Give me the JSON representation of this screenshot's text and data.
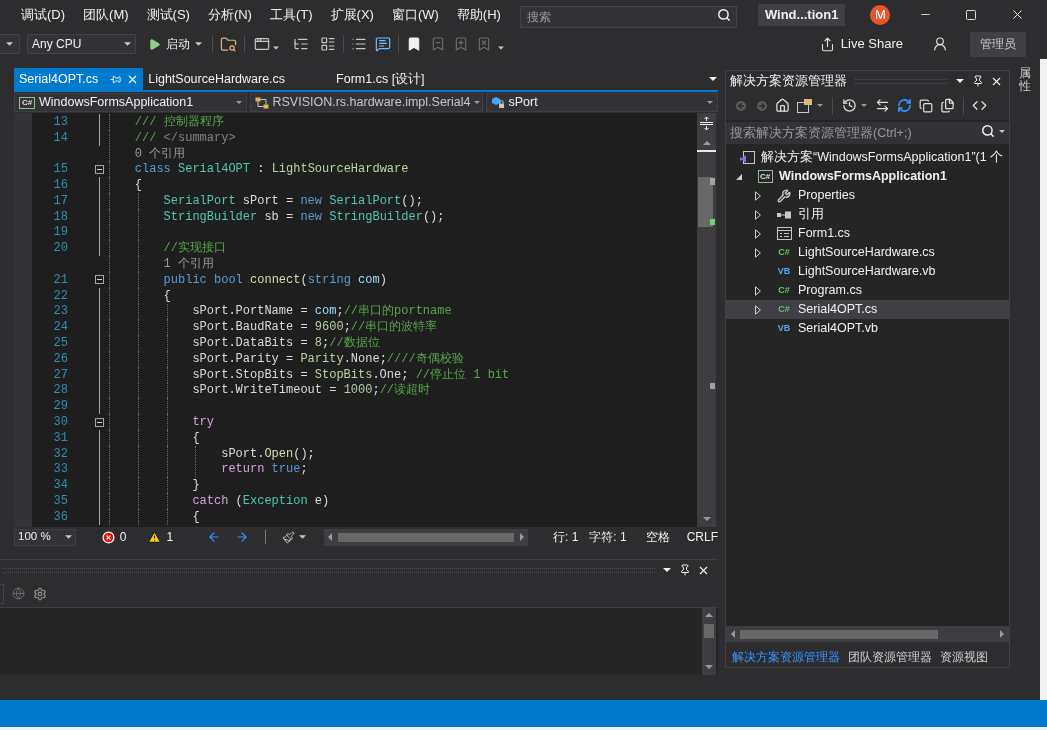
{
  "menu_bar": {
    "items": [
      "调试(D)",
      "团队(M)",
      "测试(S)",
      "分析(N)",
      "工具(T)",
      "扩展(X)",
      "窗口(W)",
      "帮助(H)"
    ],
    "search": {
      "placeholder": "搜索"
    },
    "solution_title": "Wind...tion1",
    "avatar": "M"
  },
  "toolbar": {
    "platform": "Any CPU",
    "start": "启动",
    "live_share": "Live Share",
    "account": "管理员"
  },
  "editor": {
    "tabs": [
      {
        "label": "Serial4OPT.cs",
        "selected": true
      },
      {
        "label": "LightSourceHardware.cs",
        "selected": false
      },
      {
        "label": "Form1.cs [设计]",
        "selected": false
      }
    ],
    "navigation": [
      {
        "kind": "project",
        "icon_text": "C#",
        "text": "WindowsFormsApplication1"
      },
      {
        "kind": "class",
        "text": "RSVISION.rs.hardware.impl.Serial4"
      },
      {
        "kind": "field",
        "text": "sPort"
      }
    ],
    "lines": [
      {
        "kind": "code",
        "number": "13",
        "tokens": [
          {
            "kind": "comment",
            "text": "/// 控制器程序"
          }
        ]
      },
      {
        "kind": "code",
        "number": "14",
        "tokens": [
          {
            "kind": "comment",
            "text": "///"
          },
          {
            "kind": "doc",
            "text": " </summary>"
          }
        ]
      },
      {
        "kind": "codelens",
        "text": "0 个引用"
      },
      {
        "kind": "code",
        "number": "15",
        "expanded": true,
        "tokens": [
          {
            "kind": "keyword",
            "text": "class"
          },
          {
            "kind": "type",
            "text": " Serial4OPT"
          },
          {
            "kind": "plain",
            "text": " : "
          },
          {
            "kind": "enum",
            "text": "LightSourceHardware"
          }
        ]
      },
      {
        "kind": "code",
        "number": "16",
        "tokens": [
          {
            "kind": "plain",
            "text": "{"
          }
        ],
        "children": [
          {
            "kind": "code",
            "number": "17",
            "tokens": [
              {
                "kind": "type",
                "text": "SerialPort"
              },
              {
                "kind": "plain",
                "text": " sPort = "
              },
              {
                "kind": "keyword",
                "text": "new"
              },
              {
                "kind": "type",
                "text": " SerialPort"
              },
              {
                "kind": "plain",
                "text": "();"
              }
            ]
          },
          {
            "kind": "code",
            "number": "18",
            "tokens": [
              {
                "kind": "type",
                "text": "StringBuilder"
              },
              {
                "kind": "plain",
                "text": " sb = "
              },
              {
                "kind": "keyword",
                "text": "new"
              },
              {
                "kind": "type",
                "text": " StringBuilder"
              },
              {
                "kind": "plain",
                "text": "();"
              }
            ]
          },
          {
            "kind": "code",
            "number": "19"
          },
          {
            "kind": "code",
            "number": "20",
            "tokens": [
              {
                "kind": "comment",
                "text": "//实现接口"
              }
            ]
          },
          {
            "kind": "codelens",
            "text": "1 个引用"
          },
          {
            "kind": "code",
            "number": "21",
            "expanded": true,
            "tokens": [
              {
                "kind": "keyword",
                "text": "public"
              },
              {
                "kind": "keyword",
                "text": " bool"
              },
              {
                "kind": "method",
                "text": " connect"
              },
              {
                "kind": "plain",
                "text": "("
              },
              {
                "kind": "keyword",
                "text": "string"
              },
              {
                "kind": "param",
                "text": " com"
              },
              {
                "kind": "plain",
                "text": ")"
              }
            ]
          },
          {
            "kind": "code",
            "number": "22",
            "tokens": [
              {
                "kind": "plain",
                "text": "{"
              }
            ],
            "children": [
              {
                "kind": "code",
                "number": "23",
                "tokens": [
                  {
                    "kind": "plain",
                    "text": "sPort.PortName = "
                  },
                  {
                    "kind": "param",
                    "text": "com"
                  },
                  {
                    "kind": "plain",
                    "text": ";"
                  },
                  {
                    "kind": "comment",
                    "text": "//串口的portname"
                  }
                ]
              },
              {
                "kind": "code",
                "number": "24",
                "tokens": [
                  {
                    "kind": "plain",
                    "text": "sPort.BaudRate = "
                  },
                  {
                    "kind": "number",
                    "text": "9600"
                  },
                  {
                    "kind": "plain",
                    "text": ";"
                  },
                  {
                    "kind": "comment",
                    "text": "//串口的波特率"
                  }
                ]
              },
              {
                "kind": "code",
                "number": "25",
                "tokens": [
                  {
                    "kind": "plain",
                    "text": "sPort.DataBits = "
                  },
                  {
                    "kind": "number",
                    "text": "8"
                  },
                  {
                    "kind": "plain",
                    "text": ";"
                  },
                  {
                    "kind": "comment",
                    "text": "//数据位"
                  }
                ]
              },
              {
                "kind": "code",
                "number": "26",
                "tokens": [
                  {
                    "kind": "plain",
                    "text": "sPort.Parity = "
                  },
                  {
                    "kind": "enum",
                    "text": "Parity"
                  },
                  {
                    "kind": "plain",
                    "text": ".None;"
                  },
                  {
                    "kind": "comment",
                    "text": "////奇偶校验"
                  }
                ]
              },
              {
                "kind": "code",
                "number": "27",
                "tokens": [
                  {
                    "kind": "plain",
                    "text": "sPort.StopBits = "
                  },
                  {
                    "kind": "enum",
                    "text": "StopBits"
                  },
                  {
                    "kind": "plain",
                    "text": ".One; "
                  },
                  {
                    "kind": "comment",
                    "text": "//停止位 1 bit"
                  }
                ]
              },
              {
                "kind": "code",
                "number": "28",
                "tokens": [
                  {
                    "kind": "plain",
                    "text": "sPort.WriteTimeout = "
                  },
                  {
                    "kind": "number",
                    "text": "1000"
                  },
                  {
                    "kind": "plain",
                    "text": ";"
                  },
                  {
                    "kind": "comment",
                    "text": "//读超时"
                  }
                ]
              },
              {
                "kind": "code",
                "number": "29"
              },
              {
                "kind": "code",
                "number": "30",
                "expanded": true,
                "tokens": [
                  {
                    "kind": "control",
                    "text": "try"
                  }
                ]
              },
              {
                "kind": "code",
                "number": "31",
                "tokens": [
                  {
                    "kind": "plain",
                    "text": "{"
                  }
                ],
                "children": [
                  {
                    "kind": "code",
                    "number": "32",
                    "tokens": [
                      {
                        "kind": "plain",
                        "text": "sPort."
                      },
                      {
                        "kind": "method",
                        "text": "Open"
                      },
                      {
                        "kind": "plain",
                        "text": "();"
                      }
                    ]
                  },
                  {
                    "kind": "code",
                    "number": "33",
                    "tokens": [
                      {
                        "kind": "control",
                        "text": "return"
                      },
                      {
                        "kind": "keyword",
                        "text": " true"
                      },
                      {
                        "kind": "plain",
                        "text": ";"
                      }
                    ]
                  }
                ]
              },
              {
                "kind": "code",
                "number": "34",
                "tokens": [
                  {
                    "kind": "plain",
                    "text": "}"
                  }
                ]
              },
              {
                "kind": "code",
                "number": "35",
                "tokens": [
                  {
                    "kind": "control",
                    "text": "catch"
                  },
                  {
                    "kind": "plain",
                    "text": " ("
                  },
                  {
                    "kind": "type",
                    "text": "Exception"
                  },
                  {
                    "kind": "plain",
                    "text": " e)"
                  }
                ]
              },
              {
                "kind": "code",
                "number": "36",
                "tokens": [
                  {
                    "kind": "plain",
                    "text": "{"
                  }
                ]
              }
            ]
          }
        ]
      }
    ],
    "status": {
      "zoom": "100 %",
      "errors": "0",
      "warnings": "1",
      "line": "行: 1",
      "column": "字符: 1",
      "indentation": "空格",
      "line_ending": "CRLF"
    }
  },
  "solution_explorer": {
    "title": "解决方案资源管理器",
    "search": {
      "placeholder": "搜索解决方案资源管理器(Ctrl+;)"
    },
    "tree": [
      {
        "kind": "solution",
        "label": "解决方案“WindowsFormsApplication1”(1 个",
        "selected": false,
        "children": [
          {
            "kind": "project",
            "icon_text": "C#",
            "label": "WindowsFormsApplication1",
            "expanded": true,
            "selected": false,
            "children": [
              {
                "kind": "properties",
                "label": "Properties",
                "expanded": false,
                "selected": false
              },
              {
                "kind": "references",
                "label": "引用",
                "expanded": false,
                "selected": false
              },
              {
                "kind": "form",
                "label": "Form1.cs",
                "expanded": false,
                "selected": false
              },
              {
                "kind": "csharp",
                "icon_text": "C#",
                "label": "LightSourceHardware.cs",
                "expanded": false,
                "selected": false
              },
              {
                "kind": "vb",
                "icon_text": "VB",
                "label": "LightSourceHardware.vb",
                "selected": false
              },
              {
                "kind": "csharp",
                "icon_text": "C#",
                "label": "Program.cs",
                "expanded": false,
                "selected": false
              },
              {
                "kind": "csharp",
                "icon_text": "C#",
                "label": "Serial4OPT.cs",
                "expanded": false,
                "selected": true
              },
              {
                "kind": "vb",
                "icon_text": "VB",
                "label": "Serial4OPT.vb",
                "selected": false
              }
            ]
          }
        ]
      }
    ],
    "bottom_tabs": [
      {
        "label": "解决方案资源管理器",
        "selected": true
      },
      {
        "label": "团队资源管理器",
        "selected": false
      },
      {
        "label": "资源视图",
        "selected": false
      }
    ]
  },
  "side_tabs": [
    {
      "label": "属性"
    }
  ]
}
